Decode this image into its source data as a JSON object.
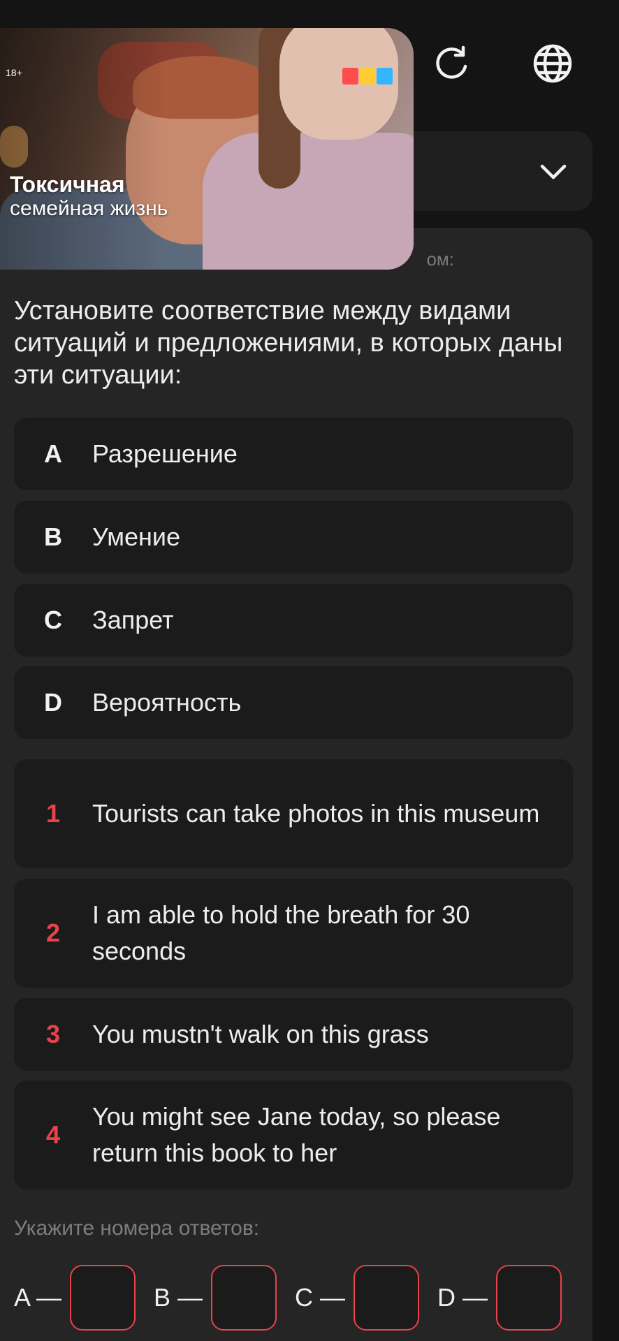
{
  "header": {
    "refresh_icon": "refresh-icon",
    "globe_icon": "globe-icon"
  },
  "dropdown": {
    "icon": "chevron-down-icon"
  },
  "video": {
    "age_rating": "18+",
    "channel_logo": "ТНТ",
    "title": "Токсичная",
    "subtitle": "семейная жизнь"
  },
  "task": {
    "instruction_fragment": "ом:",
    "question": "Установите соответствие между видами ситуаций и предложениями, в которых даны эти ситуации:",
    "options": [
      {
        "key": "A",
        "text": "Разрешение"
      },
      {
        "key": "B",
        "text": "Умение"
      },
      {
        "key": "C",
        "text": "Запрет"
      },
      {
        "key": "D",
        "text": "Вероятность"
      }
    ],
    "sentences": [
      {
        "num": "1",
        "text": "Tourists can take photos in this museum"
      },
      {
        "num": "2",
        "text": "I am able to hold the breath for 30 seconds"
      },
      {
        "num": "3",
        "text": "You mustn't walk on this grass"
      },
      {
        "num": "4",
        "text": "You might see Jane today, so please return this book to her"
      }
    ],
    "prompt": "Укажите номера ответов:",
    "answers": [
      {
        "label": "A —",
        "value": ""
      },
      {
        "label": "B —",
        "value": ""
      },
      {
        "label": "C —",
        "value": ""
      },
      {
        "label": "D —",
        "value": ""
      }
    ]
  },
  "colors": {
    "accent": "#e8434b",
    "background": "#141414",
    "panel": "#252525",
    "card": "#1b1b1b"
  }
}
